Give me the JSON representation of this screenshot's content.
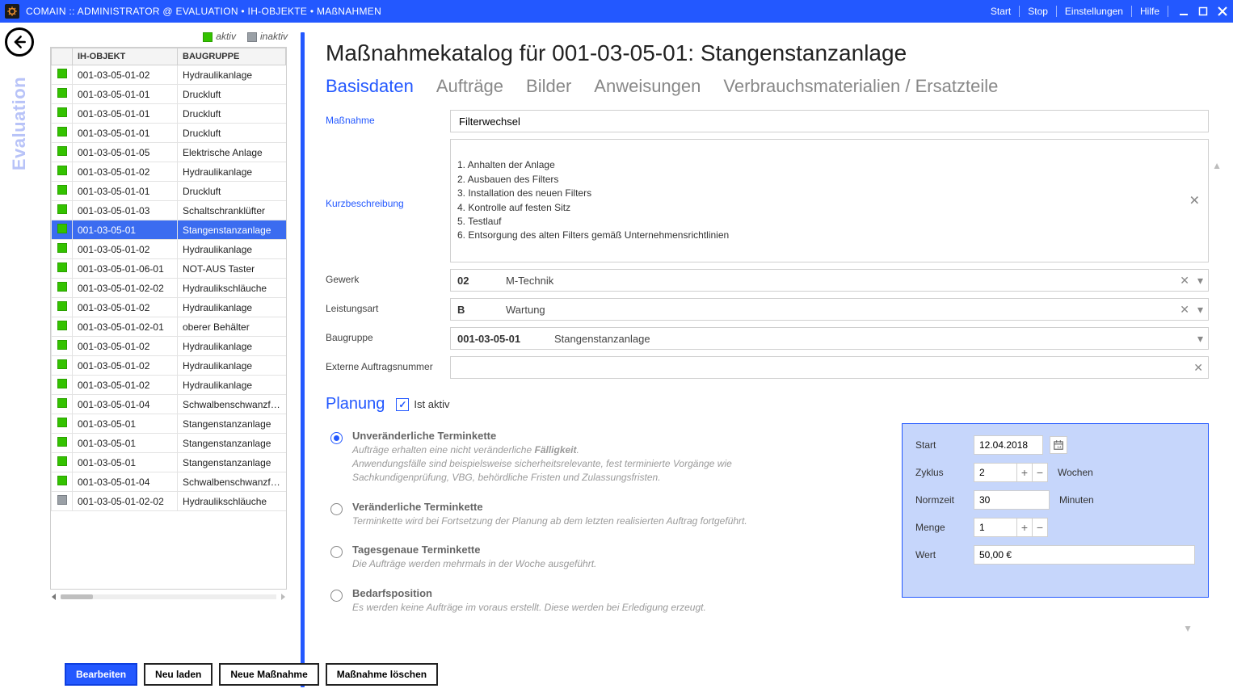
{
  "window": {
    "title": "COMAIN :: ADMINISTRATOR @ EVALUATION • IH-OBJEKTE • MAßNAHMEN",
    "menu": {
      "start": "Start",
      "stop": "Stop",
      "settings": "Einstellungen",
      "help": "Hilfe"
    }
  },
  "sidebar": {
    "vertical_label": "Evaluation",
    "legend": {
      "active": "aktiv",
      "inactive": "inaktiv"
    },
    "columns": {
      "status": "",
      "ih": "IH-OBJEKT",
      "bg": "BAUGRUPPE"
    },
    "rows": [
      {
        "status": "active",
        "ih": "001-03-05-01-02",
        "bg": "Hydraulikanlage"
      },
      {
        "status": "active",
        "ih": "001-03-05-01-01",
        "bg": "Druckluft"
      },
      {
        "status": "active",
        "ih": "001-03-05-01-01",
        "bg": "Druckluft"
      },
      {
        "status": "active",
        "ih": "001-03-05-01-01",
        "bg": "Druckluft"
      },
      {
        "status": "active",
        "ih": "001-03-05-01-05",
        "bg": "Elektrische Anlage"
      },
      {
        "status": "active",
        "ih": "001-03-05-01-02",
        "bg": "Hydraulikanlage"
      },
      {
        "status": "active",
        "ih": "001-03-05-01-01",
        "bg": "Druckluft"
      },
      {
        "status": "active",
        "ih": "001-03-05-01-03",
        "bg": "Schaltschranklüfter"
      },
      {
        "status": "active",
        "ih": "001-03-05-01",
        "bg": "Stangenstanzanlage",
        "selected": true
      },
      {
        "status": "active",
        "ih": "001-03-05-01-02",
        "bg": "Hydraulikanlage"
      },
      {
        "status": "active",
        "ih": "001-03-05-01-06-01",
        "bg": "NOT-AUS Taster"
      },
      {
        "status": "active",
        "ih": "001-03-05-01-02-02",
        "bg": "Hydraulikschläuche"
      },
      {
        "status": "active",
        "ih": "001-03-05-01-02",
        "bg": "Hydraulikanlage"
      },
      {
        "status": "active",
        "ih": "001-03-05-01-02-01",
        "bg": "oberer Behälter"
      },
      {
        "status": "active",
        "ih": "001-03-05-01-02",
        "bg": "Hydraulikanlage"
      },
      {
        "status": "active",
        "ih": "001-03-05-01-02",
        "bg": "Hydraulikanlage"
      },
      {
        "status": "active",
        "ih": "001-03-05-01-02",
        "bg": "Hydraulikanlage"
      },
      {
        "status": "active",
        "ih": "001-03-05-01-04",
        "bg": "Schwalbenschwanzführun"
      },
      {
        "status": "active",
        "ih": "001-03-05-01",
        "bg": "Stangenstanzanlage"
      },
      {
        "status": "active",
        "ih": "001-03-05-01",
        "bg": "Stangenstanzanlage"
      },
      {
        "status": "active",
        "ih": "001-03-05-01",
        "bg": "Stangenstanzanlage"
      },
      {
        "status": "active",
        "ih": "001-03-05-01-04",
        "bg": "Schwalbenschwanzführun"
      },
      {
        "status": "inactive",
        "ih": "001-03-05-01-02-02",
        "bg": "Hydraulikschläuche"
      }
    ]
  },
  "main": {
    "heading": "Maßnahmekatalog für 001-03-05-01: Stangenstanzanlage",
    "tabs": {
      "basisdaten": "Basisdaten",
      "auftraege": "Aufträge",
      "bilder": "Bilder",
      "anweisungen": "Anweisungen",
      "verbrauch": "Verbrauchsmaterialien / Ersatzteile"
    },
    "labels": {
      "massnahme": "Maßnahme",
      "kurzbeschr": "Kurzbeschreibung",
      "gewerk": "Gewerk",
      "leistungsart": "Leistungsart",
      "baugruppe": "Baugruppe",
      "extnr": "Externe Auftragsnummer"
    },
    "values": {
      "massnahme": "Filterwechsel",
      "kurzbeschr": "1. Anhalten der Anlage\n2. Ausbauen des Filters\n3. Installation des neuen Filters\n4. Kontrolle auf festen Sitz\n5. Testlauf\n6. Entsorgung des alten Filters gemäß Unternehmensrichtlinien",
      "gewerk_code": "02",
      "gewerk_text": "M-Technik",
      "leistungsart_code": "B",
      "leistungsart_text": "Wartung",
      "baugruppe_code": "001-03-05-01",
      "baugruppe_text": "Stangenstanzanlage",
      "extnr": ""
    }
  },
  "planung": {
    "title": "Planung",
    "checkbox_label": "Ist aktiv",
    "options": [
      {
        "title": "Unveränderliche Terminkette",
        "desc_pre": "Aufträge erhalten eine nicht veränderliche ",
        "desc_bold": "Fälligkeit",
        "desc_post": ".\nAnwendungsfälle sind beispielsweise sicherheitsrelevante, fest terminierte Vorgänge wie Sachkundigenprüfung, VBG, behördliche Fristen und Zulassungsfristen.",
        "checked": true
      },
      {
        "title": "Veränderliche Terminkette",
        "desc": "Terminkette wird bei Fortsetzung der Planung ab dem letzten realisierten Auftrag fortgeführt.",
        "checked": false
      },
      {
        "title": "Tagesgenaue Terminkette",
        "desc": "Die Aufträge werden mehrmals in der Woche ausgeführt.",
        "checked": false
      },
      {
        "title": "Bedarfsposition",
        "desc": "Es werden keine Aufträge im voraus erstellt. Diese werden bei Erledigung erzeugt.",
        "checked": false
      }
    ],
    "panel": {
      "labels": {
        "start": "Start",
        "zyklus": "Zyklus",
        "normzeit": "Normzeit",
        "menge": "Menge",
        "wert": "Wert"
      },
      "start": "12.04.2018",
      "zyklus": "2",
      "zyklus_unit": "Wochen",
      "normzeit": "30",
      "normzeit_unit": "Minuten",
      "menge": "1",
      "wert": "50,00 €"
    }
  },
  "footer": {
    "bearbeiten": "Bearbeiten",
    "neu_laden": "Neu laden",
    "neue": "Neue Maßnahme",
    "loeschen": "Maßnahme löschen"
  }
}
